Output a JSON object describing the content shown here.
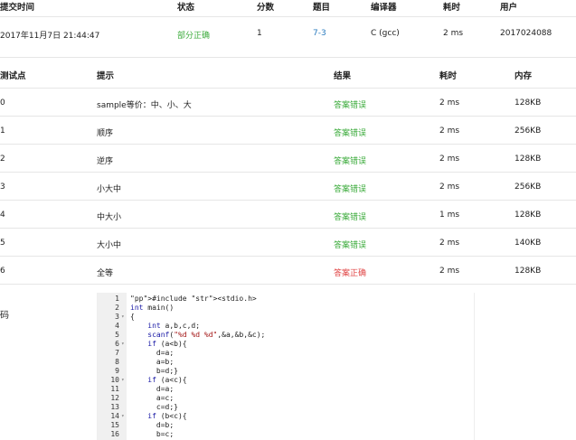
{
  "submission": {
    "headers": {
      "time": "提交时间",
      "status": "状态",
      "score": "分数",
      "problem": "题目",
      "compiler": "编译器",
      "duration": "耗时",
      "user": "用户"
    },
    "row": {
      "time": "2017年11月7日 21:44:47",
      "status": "部分正确",
      "score": "1",
      "problem": "7-3",
      "compiler": "C (gcc)",
      "duration": "2 ms",
      "user": "2017024088"
    }
  },
  "tests": {
    "headers": {
      "id": "测试点",
      "hint": "提示",
      "result": "结果",
      "duration": "耗时",
      "memory": "内存"
    },
    "rows": [
      {
        "id": "0",
        "hint": "sample等价：中、小、大",
        "result": "答案错误",
        "duration": "2 ms",
        "memory": "128KB"
      },
      {
        "id": "1",
        "hint": "顺序",
        "result": "答案错误",
        "duration": "2 ms",
        "memory": "256KB"
      },
      {
        "id": "2",
        "hint": "逆序",
        "result": "答案错误",
        "duration": "2 ms",
        "memory": "128KB"
      },
      {
        "id": "3",
        "hint": "小大中",
        "result": "答案错误",
        "duration": "2 ms",
        "memory": "256KB"
      },
      {
        "id": "4",
        "hint": "中大小",
        "result": "答案错误",
        "duration": "1 ms",
        "memory": "128KB"
      },
      {
        "id": "5",
        "hint": "大小中",
        "result": "答案错误",
        "duration": "2 ms",
        "memory": "140KB"
      },
      {
        "id": "6",
        "hint": "全等",
        "result": "答案正确",
        "duration": "2 ms",
        "memory": "128KB"
      }
    ]
  },
  "code_section": {
    "label": "码",
    "lines": [
      {
        "n": "1",
        "fold": false,
        "text": "#include <stdio.h>"
      },
      {
        "n": "2",
        "fold": false,
        "text": "int main()"
      },
      {
        "n": "3",
        "fold": true,
        "text": "{"
      },
      {
        "n": "4",
        "fold": false,
        "text": "    int a,b,c,d;"
      },
      {
        "n": "5",
        "fold": false,
        "text": "    scanf(\"%d %d %d\",&a,&b,&c);"
      },
      {
        "n": "6",
        "fold": true,
        "text": "    if (a<b){"
      },
      {
        "n": "7",
        "fold": false,
        "text": "      d=a;"
      },
      {
        "n": "8",
        "fold": false,
        "text": "      a=b;"
      },
      {
        "n": "9",
        "fold": false,
        "text": "      b=d;}"
      },
      {
        "n": "10",
        "fold": true,
        "text": "    if (a<c){"
      },
      {
        "n": "11",
        "fold": false,
        "text": "      d=a;"
      },
      {
        "n": "12",
        "fold": false,
        "text": "      a=c;"
      },
      {
        "n": "13",
        "fold": false,
        "text": "      c=d;}"
      },
      {
        "n": "14",
        "fold": true,
        "text": "    if (b<c){"
      },
      {
        "n": "15",
        "fold": false,
        "text": "      d=b;"
      },
      {
        "n": "16",
        "fold": false,
        "text": "      b=c;"
      }
    ]
  },
  "colors": {
    "error": "#3bab3b",
    "correct": "#e04545",
    "partial": "#3bab3b",
    "link": "#2a7bbf"
  }
}
